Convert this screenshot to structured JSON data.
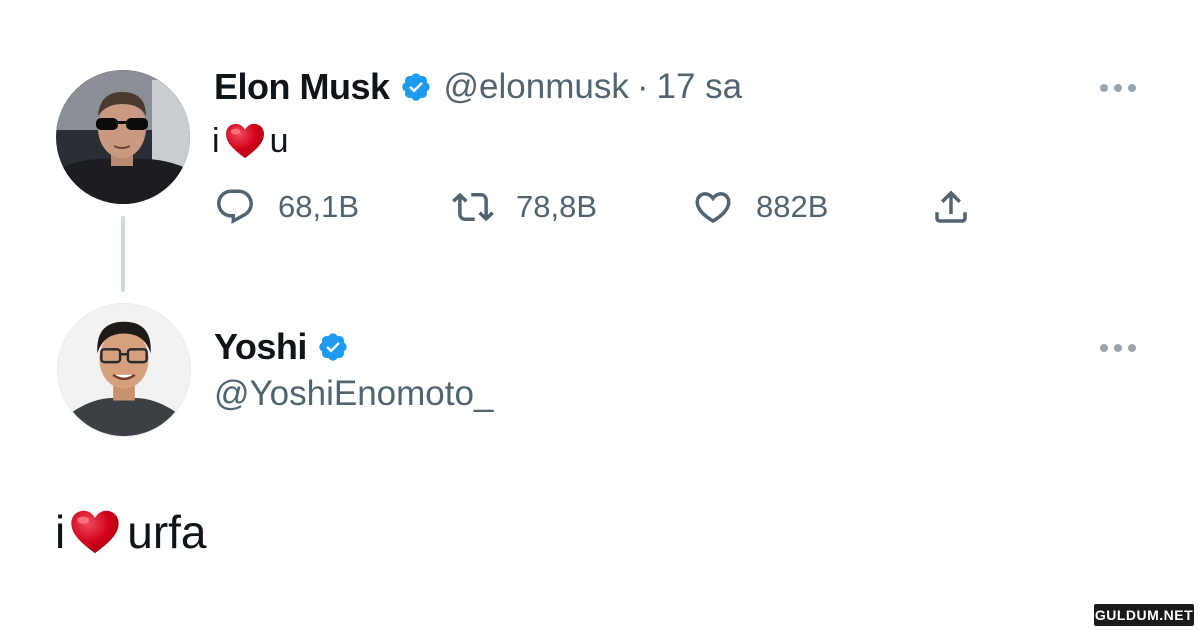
{
  "tweet_original": {
    "author_name": "Elon Musk",
    "handle": "@elonmusk",
    "separator": "·",
    "time": "17 sa",
    "text_before": "i",
    "emoji": "heart-emoji",
    "text_after": "u",
    "replies": "68,1B",
    "retweets": "78,8B",
    "likes": "882B"
  },
  "tweet_reply": {
    "author_name": "Yoshi",
    "handle": "@YoshiEnomoto_",
    "text_before": "i",
    "emoji": "heart-emoji",
    "text_after": "urfa"
  },
  "watermark": "GULDUM.NET",
  "colors": {
    "primary_text": "#0f1419",
    "secondary_text": "#536471",
    "verified_blue": "#1d9bf0",
    "heart_red": "#d0021b",
    "thread_line": "#cfd9de"
  }
}
